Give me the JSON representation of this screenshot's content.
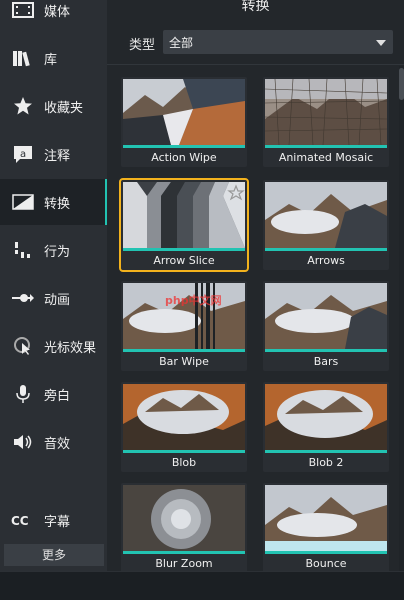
{
  "sidebar": {
    "items": [
      {
        "label": "媒体",
        "icon": "film-icon"
      },
      {
        "label": "库",
        "icon": "books-icon"
      },
      {
        "label": "收藏夹",
        "icon": "star-icon"
      },
      {
        "label": "注释",
        "icon": "annotation-icon"
      },
      {
        "label": "转换",
        "icon": "transition-icon"
      },
      {
        "label": "行为",
        "icon": "behavior-icon"
      },
      {
        "label": "动画",
        "icon": "animation-icon"
      },
      {
        "label": "光标效果",
        "icon": "cursor-effect-icon"
      },
      {
        "label": "旁白",
        "icon": "microphone-icon"
      },
      {
        "label": "音效",
        "icon": "speaker-icon"
      },
      {
        "label": "字幕",
        "icon": "captions-icon"
      }
    ],
    "active_index": 4,
    "more_label": "更多"
  },
  "main": {
    "title": "转换",
    "filter_label": "类型",
    "filter_value": "全部",
    "tiles": [
      {
        "label": "Action Wipe"
      },
      {
        "label": "Animated Mosaic"
      },
      {
        "label": "Arrow Slice"
      },
      {
        "label": "Arrows"
      },
      {
        "label": "Bar Wipe"
      },
      {
        "label": "Bars"
      },
      {
        "label": "Blob"
      },
      {
        "label": "Blob 2"
      },
      {
        "label": "Blur Zoom"
      },
      {
        "label": "Bounce"
      }
    ],
    "selected_tile": 2
  },
  "watermark": "php中文网",
  "colors": {
    "accent": "#22c3b2",
    "selection": "#f2b21d",
    "sidebar_bg": "#2b2f34",
    "main_bg": "#23272b"
  }
}
